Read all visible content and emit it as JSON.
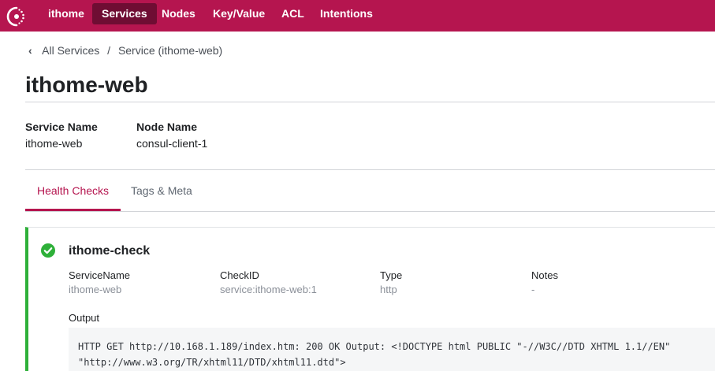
{
  "nav": {
    "logo": "consul-logo-icon",
    "datacenter": "ithome",
    "items": [
      {
        "label": "Services",
        "active": true
      },
      {
        "label": "Nodes",
        "active": false
      },
      {
        "label": "Key/Value",
        "active": false
      },
      {
        "label": "ACL",
        "active": false
      },
      {
        "label": "Intentions",
        "active": false
      }
    ]
  },
  "breadcrumb": {
    "chevron": "‹",
    "parent": "All Services",
    "separator": "/",
    "current": "Service (ithome-web)"
  },
  "page": {
    "title": "ithome-web"
  },
  "info": {
    "service_name_label": "Service Name",
    "service_name_value": "ithome-web",
    "node_name_label": "Node Name",
    "node_name_value": "consul-client-1"
  },
  "tabs": [
    {
      "label": "Health Checks",
      "active": true
    },
    {
      "label": "Tags & Meta",
      "active": false
    }
  ],
  "check": {
    "status": "passing",
    "status_color": "#2eb039",
    "name": "ithome-check",
    "fields": [
      {
        "label": "ServiceName",
        "value": "ithome-web"
      },
      {
        "label": "CheckID",
        "value": "service:ithome-web:1"
      },
      {
        "label": "Type",
        "value": "http"
      },
      {
        "label": "Notes",
        "value": "-"
      }
    ],
    "output_label": "Output",
    "output_lines": [
      "HTTP GET http://10.168.1.189/index.htm: 200 OK Output: <!DOCTYPE html PUBLIC \"-//W3C//DTD XHTML 1.1//EN\"",
      "\"http://www.w3.org/TR/xhtml11/DTD/xhtml11.dtd\">"
    ]
  },
  "colors": {
    "brand": "#b5154f",
    "brand_dark": "#6f0d33",
    "passing": "#2eb039"
  }
}
